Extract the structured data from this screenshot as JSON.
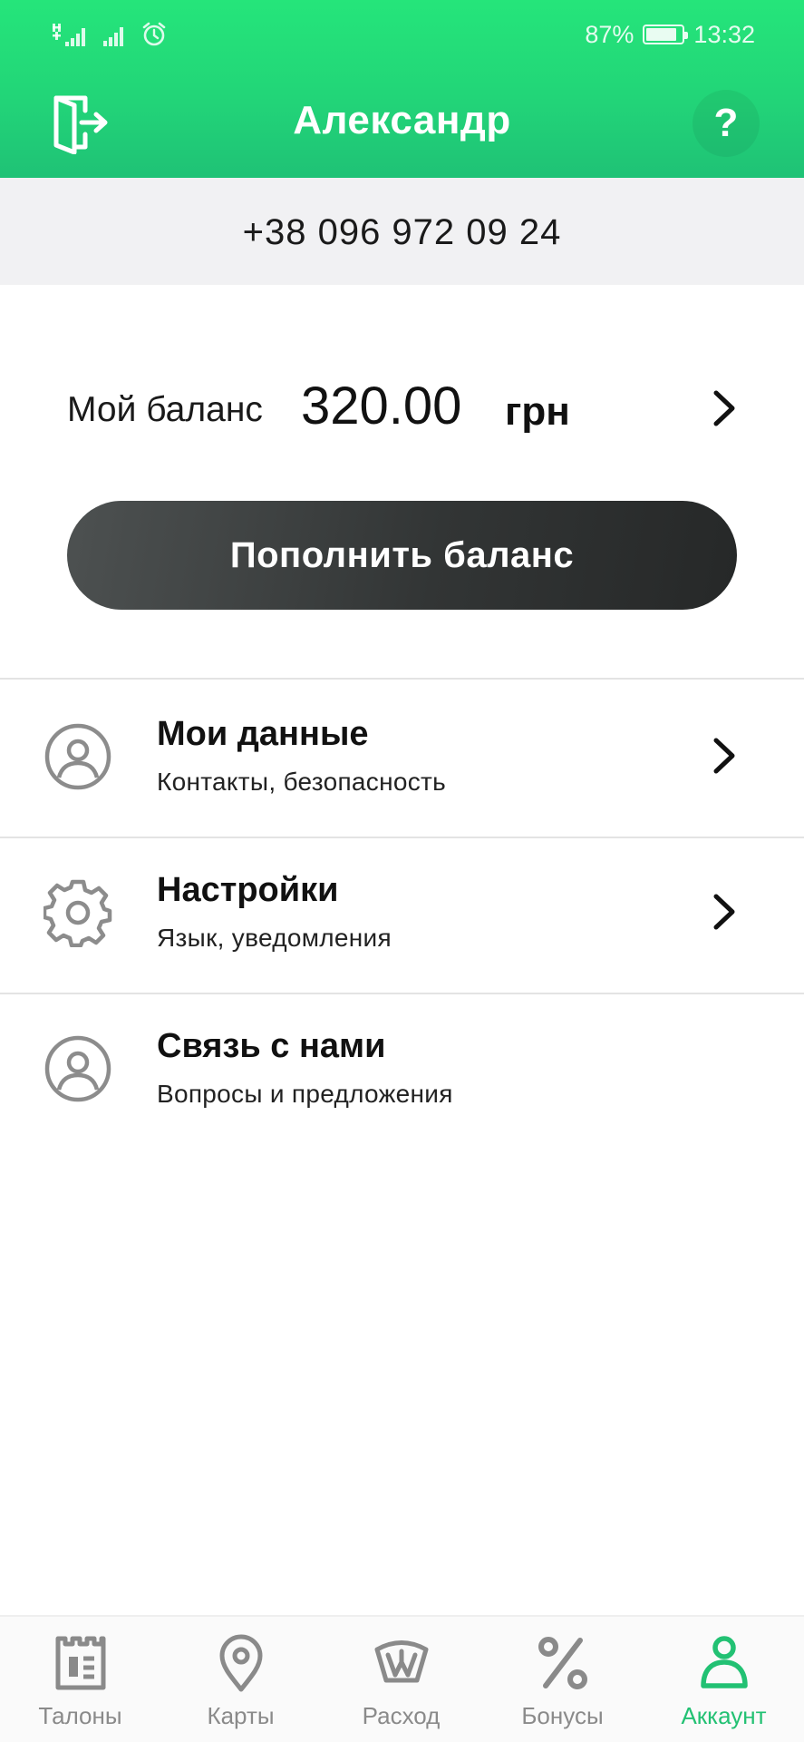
{
  "status_bar": {
    "battery_percent_text": "87%",
    "battery_level": 0.87,
    "time": "13:32",
    "signal_icons": [
      "signal-hplus-icon",
      "signal-icon",
      "alarm-icon"
    ]
  },
  "header": {
    "title": "Александр",
    "exit_icon": "exit-door-icon",
    "help_label": "?",
    "background_color": "#22d578"
  },
  "phone": "+38 096 972 09 24",
  "balance": {
    "label": "Мой баланс",
    "value": "320.00",
    "currency": "грн"
  },
  "topup_button": {
    "label": "Пополнить баланс"
  },
  "menu": [
    {
      "title": "Мои данные",
      "subtitle": "Контакты, безопасность",
      "icon": "user-circle-icon",
      "has_chevron": true
    },
    {
      "title": "Настройки",
      "subtitle": "Язык, уведомления",
      "icon": "gear-icon",
      "has_chevron": true
    },
    {
      "title": "Связь с нами",
      "subtitle": "Вопросы и предложения",
      "icon": "user-circle-icon",
      "has_chevron": false
    }
  ],
  "bottom_nav": {
    "items": [
      {
        "label": "Талоны",
        "icon": "ticket-icon"
      },
      {
        "label": "Карты",
        "icon": "map-pin-icon"
      },
      {
        "label": "Расход",
        "icon": "gauge-icon"
      },
      {
        "label": "Бонусы",
        "icon": "percent-icon"
      },
      {
        "label": "Аккаунт",
        "icon": "account-icon"
      }
    ],
    "active_index": 4,
    "active_color": "#22c173",
    "inactive_color": "#8a8a8a"
  }
}
